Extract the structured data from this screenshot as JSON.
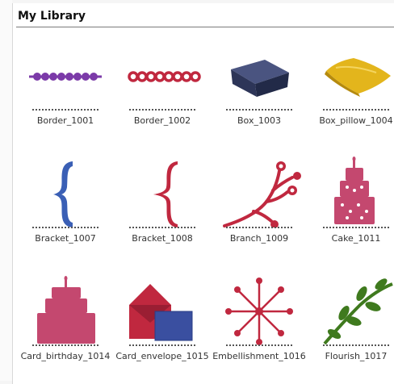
{
  "library": {
    "title": "My Library",
    "items": [
      {
        "label": "Border_1001",
        "icon": "border-beads-icon"
      },
      {
        "label": "Border_1002",
        "icon": "border-rings-icon"
      },
      {
        "label": "Box_1003",
        "icon": "box-icon"
      },
      {
        "label": "Box_pillow_1004",
        "icon": "pillow-box-icon"
      },
      {
        "label": "Bracket_1007",
        "icon": "bracket-blue-icon"
      },
      {
        "label": "Bracket_1008",
        "icon": "bracket-red-icon"
      },
      {
        "label": "Branch_1009",
        "icon": "branch-icon"
      },
      {
        "label": "Cake_1011",
        "icon": "cake-icon"
      },
      {
        "label": "Card_birthday_1014",
        "icon": "birthday-card-icon"
      },
      {
        "label": "Card_envelope_1015",
        "icon": "envelope-card-icon"
      },
      {
        "label": "Embellishment_1016",
        "icon": "starburst-icon"
      },
      {
        "label": "Flourish_1017",
        "icon": "flourish-icon"
      }
    ]
  },
  "colors": {
    "purple": "#7b3aa8",
    "red": "#c0283f",
    "navy": "#2d3558",
    "yellow": "#e3b51c",
    "blue": "#3a5fb5",
    "pink": "#c4486f",
    "green": "#3f7a1e"
  }
}
